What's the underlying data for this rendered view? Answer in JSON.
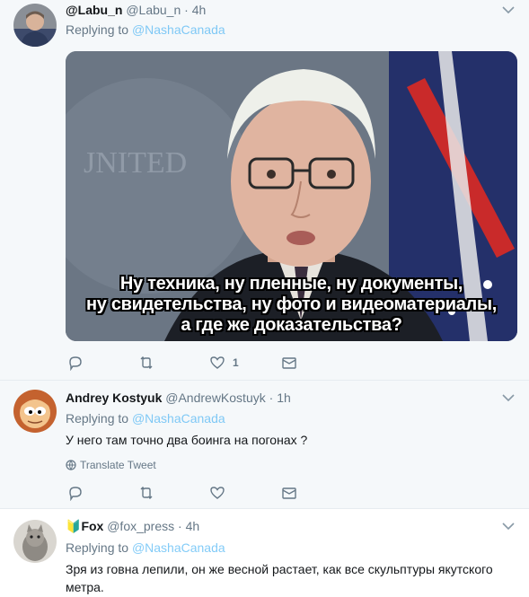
{
  "tweets": [
    {
      "name": "@Labu_n",
      "handle": "@Labu_n",
      "time": "4h",
      "replying_prefix": "Replying to",
      "replying_to": "@NashaCanada",
      "image_caption": [
        "Ну техника, ну пленные, ну документы,",
        "ну свидетельства, ну фото и видеоматериалы,",
        "а где же доказательства?"
      ],
      "likes": "1",
      "avatar_icon": "person-photo"
    },
    {
      "name": "Andrey Kostyuk",
      "handle": "@AndrewKostuyk",
      "time": "1h",
      "replying_prefix": "Replying to",
      "replying_to": "@NashaCanada",
      "text": "У него там точно два боинга на погонах ?",
      "translate": "Translate Tweet",
      "avatar_icon": "cartoon-avatar"
    },
    {
      "name_badge": "🔰",
      "name": "Fox",
      "handle": "@fox_press",
      "time": "4h",
      "replying_prefix": "Replying to",
      "replying_to": "@NashaCanada",
      "text": "Зря из говна лепили, он же весной растает, как все скульптуры якутского метра.",
      "avatar_icon": "cat-photo"
    }
  ],
  "dot": "·",
  "colors": {
    "accent": "#1da1f2",
    "muted": "#657786",
    "bg_reply": "#f5f8fa"
  }
}
